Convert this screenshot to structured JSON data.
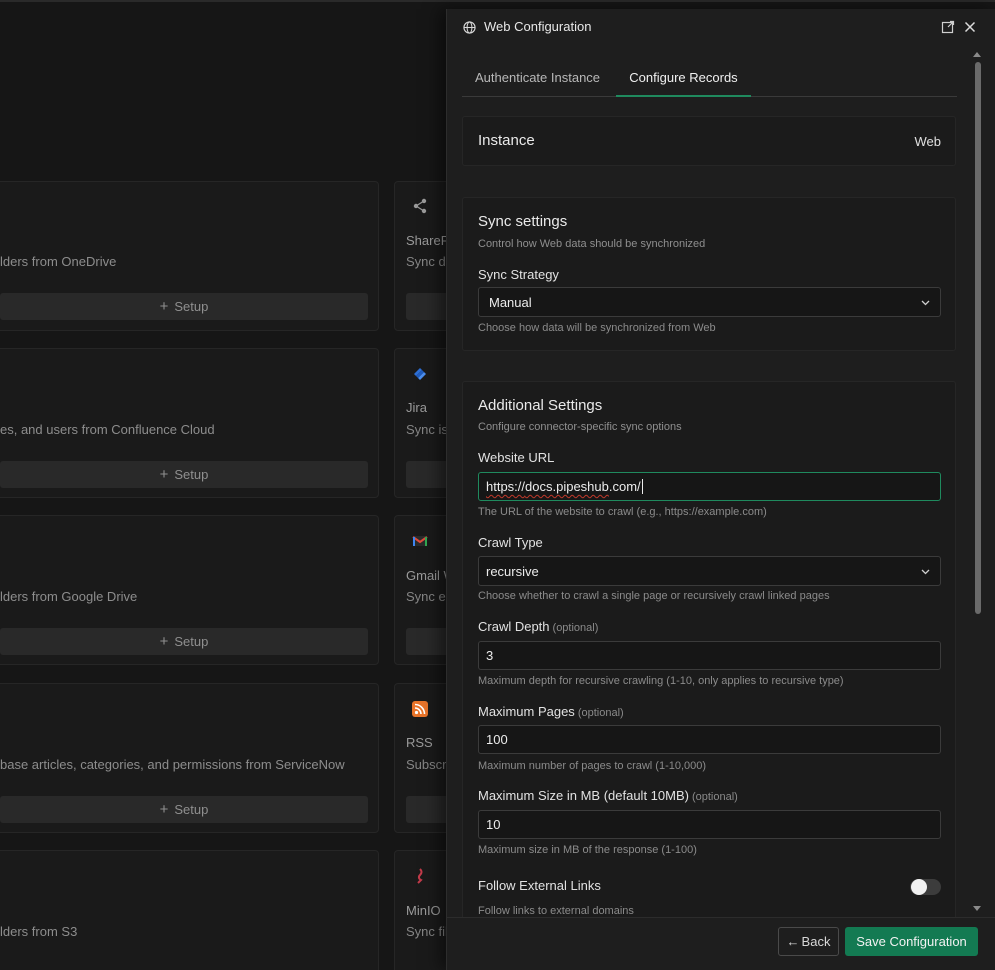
{
  "background": {
    "rows": [
      {
        "desc": "lders from OneDrive",
        "setup": "Setup",
        "right_title": "ShareP",
        "right_sub": "Sync de",
        "icon": "share-icon"
      },
      {
        "desc": "es, and users from Confluence Cloud",
        "setup": "Setup",
        "right_title": "Jira",
        "right_sub": "Sync is",
        "icon": "jira-icon"
      },
      {
        "desc": "lders from Google Drive",
        "setup": "Setup",
        "right_title": "Gmail W",
        "right_sub": "Sync er",
        "icon": "gmail-icon"
      },
      {
        "desc": "base articles, categories, and permissions from ServiceNow",
        "setup": "Setup",
        "right_title": "RSS",
        "right_sub": "Subscri",
        "icon": "rss-icon"
      },
      {
        "desc": "lders from S3",
        "setup": "",
        "right_title": "MinIO",
        "right_sub": "Sync fil",
        "icon": "minio-icon"
      }
    ]
  },
  "dialog": {
    "title": "Web Configuration",
    "tabs": [
      "Authenticate Instance",
      "Configure Records"
    ],
    "active_tab": "Configure Records",
    "instance": {
      "label": "Instance",
      "value": "Web"
    },
    "sync": {
      "heading": "Sync settings",
      "subheading": "Control how Web data should be synchronized",
      "strategy_label": "Sync Strategy",
      "strategy_value": "Manual",
      "strategy_help": "Choose how data will be synchronized from Web"
    },
    "additional": {
      "heading": "Additional Settings",
      "subheading": "Configure connector-specific sync options",
      "website_url_label": "Website URL",
      "website_url_value_a": "https://",
      "website_url_value_b": "docs.pipeshub",
      "website_url_value_c": ".com/",
      "website_url_help": "The URL of the website to crawl (e.g., https://example.com)",
      "crawl_type_label": "Crawl Type",
      "crawl_type_value": "recursive",
      "crawl_type_help": "Choose whether to crawl a single page or recursively crawl linked pages",
      "crawl_depth_label": "Crawl Depth",
      "crawl_depth_value": "3",
      "crawl_depth_help": "Maximum depth for recursive crawling (1-10, only applies to recursive type)",
      "max_pages_label": "Maximum Pages",
      "max_pages_value": "100",
      "max_pages_help": "Maximum number of pages to crawl (1-10,000)",
      "max_size_label": "Maximum Size in MB (default 10MB)",
      "max_size_value": "10",
      "max_size_help": "Maximum size in MB of the response (1-100)",
      "follow_label": "Follow External Links",
      "follow_help": "Follow links to external domains",
      "follow_enabled": false,
      "optional": "(optional)"
    },
    "footer": {
      "back": "Back",
      "back_arrow": "←",
      "save": "Save Configuration"
    }
  },
  "colors": {
    "accent": "#137a52",
    "focus": "#1f8a5e",
    "jira": "#2d6fd6",
    "rss": "#e8742a",
    "minio": "#c23b4a"
  }
}
